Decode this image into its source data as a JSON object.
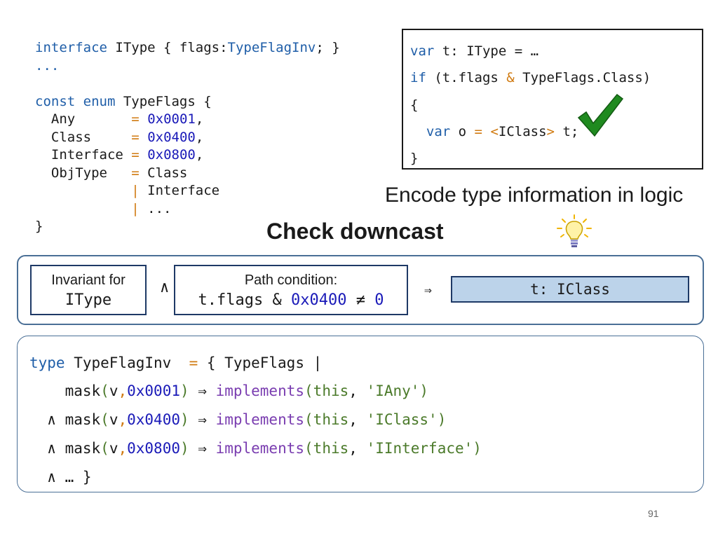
{
  "left_code": {
    "l1": {
      "kw": "interface",
      "text": " IType { flags:",
      "type": "TypeFlagInv",
      "end": "; }"
    },
    "l2": "...",
    "l3": {
      "kw": "const enum",
      "text": " TypeFlags {"
    },
    "rows": [
      {
        "name": "  Any       ",
        "eq": "=",
        "val": "0x0001",
        "end": ","
      },
      {
        "name": "  Class     ",
        "eq": "=",
        "val": "0x0400",
        "end": ","
      },
      {
        "name": "  Interface ",
        "eq": "=",
        "val": "0x0800",
        "end": ","
      },
      {
        "name": "  ObjType   ",
        "eq": "=",
        "val": " Class",
        "end": ""
      }
    ],
    "cont1": {
      "pad": "            ",
      "bar": "|",
      "text": " Interface"
    },
    "cont2": {
      "pad": "            ",
      "bar": "|",
      "text": " ..."
    },
    "close": "}"
  },
  "box_code": {
    "l1": {
      "kw": "var",
      "text": " t: IType = …"
    },
    "l2": {
      "kw": "if",
      "a": " (t.flags ",
      "op": "&",
      "b": " TypeFlags.Class)"
    },
    "l3": "{",
    "l4": {
      "pad": "  ",
      "kw": "var",
      "a": " o ",
      "eq": "=",
      "sp": " ",
      "lt": "<",
      "cls": "IClass",
      "gt": ">",
      "b": " t;"
    },
    "l5": "}"
  },
  "encode_caption": "Encode type information in logic",
  "downcast_title": "Check downcast",
  "invariant": {
    "caption": "Invariant for",
    "code": "IType"
  },
  "and_symbol": "∧",
  "path_condition": {
    "caption": "Path condition:",
    "pre": "t.flags & ",
    "num": "0x0400",
    "mid": " ≠ ",
    "zero": "0"
  },
  "implies_symbol": "⇒",
  "result": "t: IClass",
  "bottom_code": {
    "l1": {
      "kw": "type",
      "a": " TypeFlagInv  ",
      "eq": "=",
      "b": " { TypeFlags |"
    },
    "rows": [
      {
        "pre": "    ",
        "fn": "mask",
        "v": "v",
        "num": "0x0001",
        "imp": " ⇒ ",
        "impl": "implements",
        "self": "this",
        "str": "'IAny'"
      },
      {
        "pre": "  ∧ ",
        "fn": "mask",
        "v": "v",
        "num": "0x0400",
        "imp": " ⇒ ",
        "impl": "implements",
        "self": "this",
        "str": "'IClass'"
      },
      {
        "pre": "  ∧ ",
        "fn": "mask",
        "v": "v",
        "num": "0x0800",
        "imp": " ⇒ ",
        "impl": "implements",
        "self": "this",
        "str": "'IInterface'"
      }
    ],
    "last": "  ∧ … }"
  },
  "page_number": "91",
  "colors": {
    "keyword": "#1f5ea8",
    "operator": "#d07a10",
    "number": "#1a1ab8",
    "function": "#7a3db0",
    "string": "#4b7a2a",
    "panel_border": "#4a6f96",
    "result_fill": "#bcd3ea",
    "check": "#1f8a1f"
  }
}
